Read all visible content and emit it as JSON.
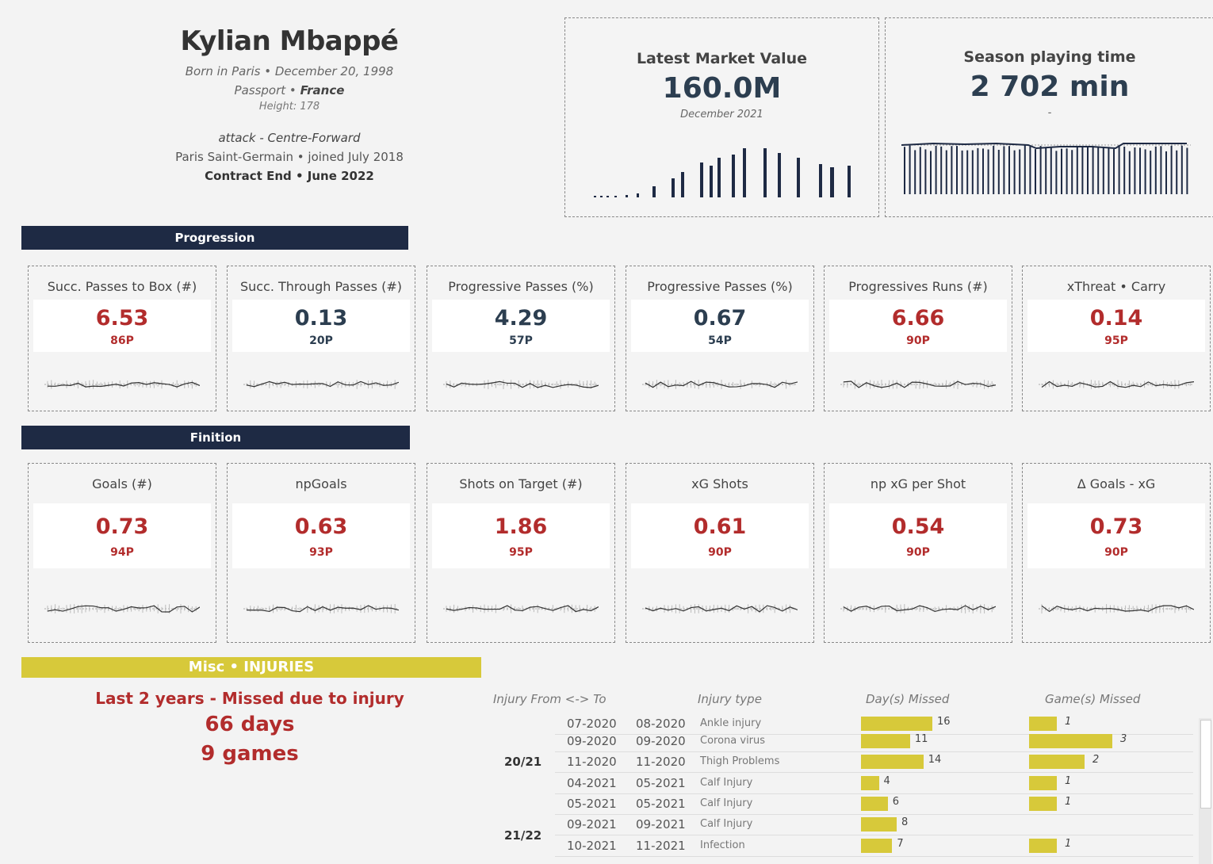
{
  "player": {
    "name": "Kylian Mbappé",
    "born": "Born in Paris • December 20, 1998",
    "passport_label": "Passport •",
    "passport_value": "France",
    "height": "Height: 178",
    "position": "attack - Centre-Forward",
    "club": "Paris Saint-Germain •  joined July 2018",
    "contract": "Contract End • June 2022"
  },
  "market": {
    "title": "Latest Market Value",
    "value": "160.0M",
    "date": "December 2021"
  },
  "playtime": {
    "title": "Season playing time",
    "value": "2 702 min",
    "sub": "-"
  },
  "sections": {
    "progression": "Progression",
    "finition": "Finition",
    "misc": "Misc • INJURIES"
  },
  "progression_cards": [
    {
      "title": "Succ. Passes to Box (#)",
      "value": "6.53",
      "pct": "86P",
      "color": "#b22c2c"
    },
    {
      "title": "Succ. Through Passes (#)",
      "value": "0.13",
      "pct": "20P",
      "color": "#2c3e50"
    },
    {
      "title": "Progressive Passes (%)",
      "value": "4.29",
      "pct": "57P",
      "color": "#2c3e50"
    },
    {
      "title": "Progressive Passes (%)",
      "value": "0.67",
      "pct": "54P",
      "color": "#2c3e50"
    },
    {
      "title": "Progressives Runs (#)",
      "value": "6.66",
      "pct": "90P",
      "color": "#b22c2c"
    },
    {
      "title": "xThreat • Carry",
      "value": "0.14",
      "pct": "95P",
      "color": "#b22c2c"
    }
  ],
  "finition_cards": [
    {
      "title": "Goals (#)",
      "value": "0.73",
      "pct": "94P",
      "color": "#b22c2c"
    },
    {
      "title": "npGoals",
      "value": "0.63",
      "pct": "93P",
      "color": "#b22c2c"
    },
    {
      "title": "Shots on Target (#)",
      "value": "1.86",
      "pct": "95P",
      "color": "#b22c2c"
    },
    {
      "title": "xG Shots",
      "value": "0.61",
      "pct": "90P",
      "color": "#b22c2c"
    },
    {
      "title": "np xG per Shot",
      "value": "0.54",
      "pct": "90P",
      "color": "#b22c2c"
    },
    {
      "title": "Δ Goals - xG",
      "value": "0.73",
      "pct": "90P",
      "color": "#b22c2c"
    }
  ],
  "injury_summary": {
    "title": "Last 2 years - Missed due to injury",
    "days": "66 days",
    "games": "9 games"
  },
  "injury_table": {
    "headers": [
      "Injury From <-> To",
      "Injury type",
      "Day(s) Missed",
      "Game(s) Missed"
    ],
    "seasons": [
      "20/21",
      "21/22"
    ],
    "rows": [
      {
        "from": "07-2020",
        "to": "08-2020",
        "type": "Ankle injury",
        "days": "16",
        "games": "1"
      },
      {
        "from": "09-2020",
        "to": "09-2020",
        "type": "Corona virus",
        "days": "11",
        "games": "3"
      },
      {
        "from": "11-2020",
        "to": "11-2020",
        "type": "Thigh Problems",
        "days": "14",
        "games": "2"
      },
      {
        "from": "04-2021",
        "to": "05-2021",
        "type": "Calf Injury",
        "days": "4",
        "games": "1"
      },
      {
        "from": "05-2021",
        "to": "05-2021",
        "type": "Calf Injury",
        "days": "6",
        "games": "1"
      },
      {
        "from": "09-2021",
        "to": "09-2021",
        "type": "Calf Injury",
        "days": "8",
        "games": ""
      },
      {
        "from": "10-2021",
        "to": "11-2021",
        "type": "Infection",
        "days": "7",
        "games": "1"
      }
    ]
  },
  "colors": {
    "accent_red": "#b22c2c",
    "navy": "#1e2a44",
    "mustard": "#d7c93a"
  }
}
